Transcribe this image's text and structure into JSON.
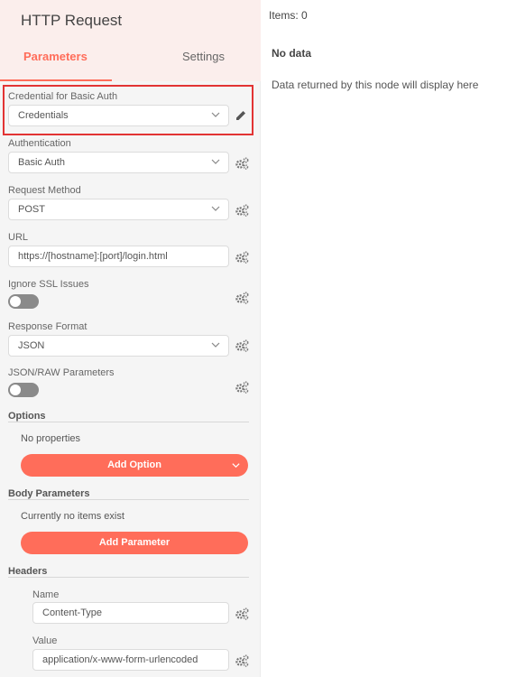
{
  "node": {
    "title": "HTTP Request"
  },
  "tabs": {
    "parameters": "Parameters",
    "settings": "Settings"
  },
  "fields": {
    "credential": {
      "label": "Credential for Basic Auth",
      "value": "Credentials"
    },
    "authentication": {
      "label": "Authentication",
      "value": "Basic Auth"
    },
    "request_method": {
      "label": "Request Method",
      "value": "POST"
    },
    "url": {
      "label": "URL",
      "value": "https://[hostname]:[port]/login.html"
    },
    "ignore_ssl": {
      "label": "Ignore SSL Issues",
      "enabled": false
    },
    "response_format": {
      "label": "Response Format",
      "value": "JSON"
    },
    "json_raw": {
      "label": "JSON/RAW Parameters",
      "enabled": false
    }
  },
  "options": {
    "title": "Options",
    "empty_text": "No properties",
    "button": "Add Option"
  },
  "body_parameters": {
    "title": "Body Parameters",
    "empty_text": "Currently no items exist",
    "button": "Add Parameter"
  },
  "headers": {
    "title": "Headers",
    "name_label": "Name",
    "name_value": "Content-Type",
    "value_label": "Value",
    "value_value": "application/x-www-form-urlencoded"
  },
  "output": {
    "items_label": "Items: 0",
    "no_data": "No data",
    "hint": "Data returned by this node will display here"
  },
  "colors": {
    "accent": "#ff6d5a",
    "highlight": "#e23434",
    "toggle_off": "#8a8a8a"
  }
}
